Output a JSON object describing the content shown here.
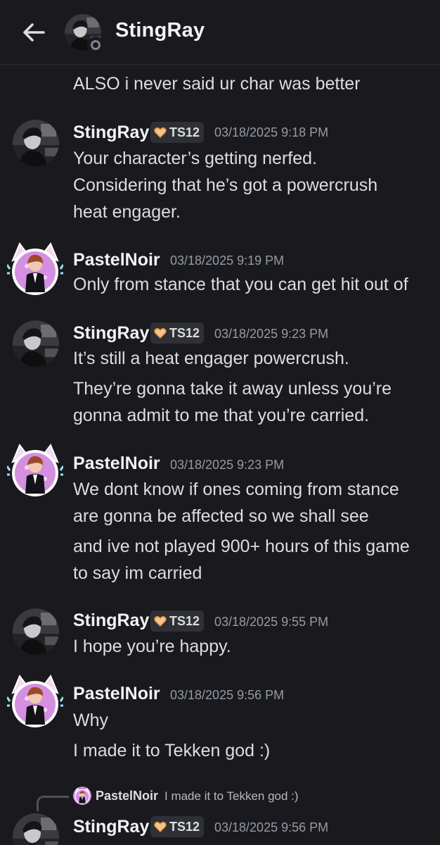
{
  "header": {
    "title": "StingRay",
    "back_icon": "arrow-left-icon",
    "status_icon": "status-offline-icon"
  },
  "colors": {
    "background": "#1a1a1e",
    "text": "#dbdee1",
    "timestamp": "#949ba4",
    "tag_bg": "#2e3035"
  },
  "messages": [
    {
      "text": "ALSO i never said ur char was better"
    },
    {
      "author": "StingRay",
      "tag": "TS12",
      "tag_icon": "heart-badge-icon",
      "time": "03/18/2025 9:18 PM",
      "lines": [
        "Your character’s getting nerfed.",
        "Considering that he’s got a powercrush",
        "heat engager."
      ]
    },
    {
      "author": "PastelNoir",
      "time": "03/18/2025 9:19 PM",
      "lines": [
        "Only from stance that you can get hit out of"
      ]
    },
    {
      "author": "StingRay",
      "tag": "TS12",
      "tag_icon": "heart-badge-icon",
      "time": "03/18/2025 9:23 PM",
      "lines": [
        "It’s still a heat engager powercrush.",
        "They’re gonna take it away unless you’re",
        "gonna admit to me that you’re carried."
      ]
    },
    {
      "author": "PastelNoir",
      "time": "03/18/2025 9:23 PM",
      "lines": [
        "We dont know if ones coming from stance",
        "are gonna be affected so we shall see",
        "and ive not played 900+ hours of this game",
        "to say im carried"
      ]
    },
    {
      "author": "StingRay",
      "tag": "TS12",
      "tag_icon": "heart-badge-icon",
      "time": "03/18/2025 9:55 PM",
      "lines": [
        "I hope you’re happy."
      ]
    },
    {
      "author": "PastelNoir",
      "time": "03/18/2025 9:56 PM",
      "lines": [
        "Why",
        "I made it to Tekken god :)"
      ]
    },
    {
      "author": "StingRay",
      "tag": "TS12",
      "tag_icon": "heart-badge-icon",
      "time": "03/18/2025 9:56 PM",
      "reply": {
        "author": "PastelNoir",
        "text": "I made it to Tekken god :)"
      }
    }
  ]
}
